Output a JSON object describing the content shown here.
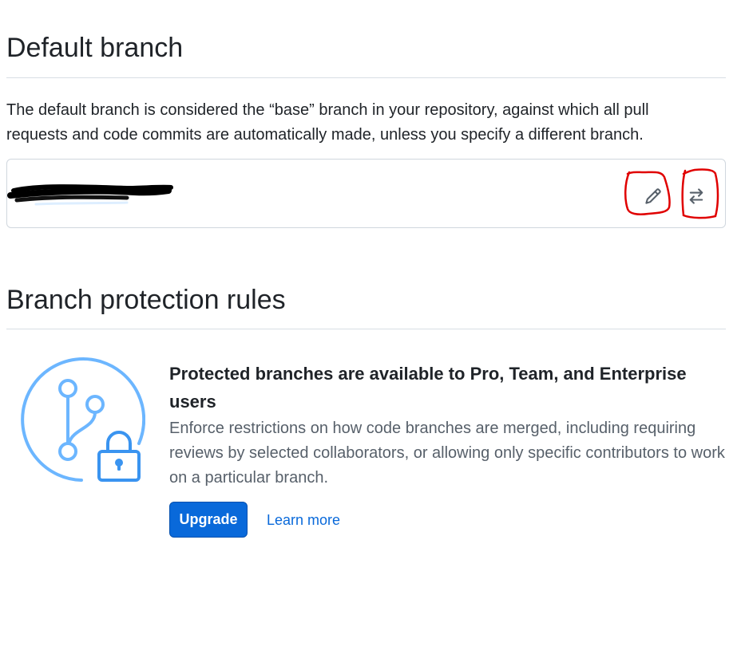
{
  "default_branch": {
    "title": "Default branch",
    "description": "The default branch is considered the “base” branch in your repository, against which all pull requests and code commits are automatically made, unless you specify a different branch.",
    "branch_name_redacted": true,
    "edit_icon": "pencil-icon",
    "switch_icon": "arrow-switch-icon"
  },
  "branch_protection": {
    "title": "Branch protection rules",
    "promo_icon": "git-branch-lock-icon",
    "heading": "Protected branches are available to Pro, Team, and Enterprise users",
    "text": "Enforce restrictions on how code branches are merged, including requiring reviews by selected collaborators, or allowing only specific contributors to work on a particular branch.",
    "upgrade_label": "Upgrade",
    "learn_more_label": "Learn more"
  },
  "colors": {
    "accent": "#0969da",
    "icon_light_blue": "#6cb6ff",
    "annotation_red": "#e00000",
    "muted_text": "#57606a",
    "border": "#d0d7de"
  }
}
